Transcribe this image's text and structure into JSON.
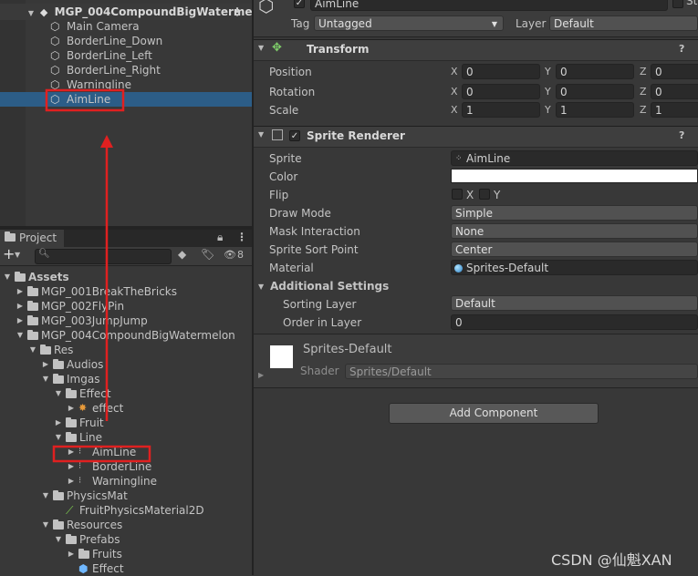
{
  "hierarchy": {
    "scene_name": "MGP_004CompoundBigWaterme",
    "items": [
      "Main Camera",
      "BorderLine_Down",
      "BorderLine_Left",
      "BorderLine_Right",
      "Warningline",
      "AimLine"
    ],
    "selected": "AimLine"
  },
  "project": {
    "tab_label": "Project",
    "add_label": "+",
    "hidden_count": "8",
    "tree": [
      {
        "label": "Assets",
        "depth": 0,
        "type": "folder",
        "arrow": "down",
        "bold": true
      },
      {
        "label": "MGP_001BreakTheBricks",
        "depth": 1,
        "type": "folder",
        "arrow": "right"
      },
      {
        "label": "MGP_002FlyPin",
        "depth": 1,
        "type": "folder",
        "arrow": "right"
      },
      {
        "label": "MGP_003JumpJump",
        "depth": 1,
        "type": "folder",
        "arrow": "right"
      },
      {
        "label": "MGP_004CompoundBigWatermelon",
        "depth": 1,
        "type": "folder",
        "arrow": "down"
      },
      {
        "label": "Res",
        "depth": 2,
        "type": "folder",
        "arrow": "down"
      },
      {
        "label": "Audios",
        "depth": 3,
        "type": "folder",
        "arrow": "right"
      },
      {
        "label": "Imgas",
        "depth": 3,
        "type": "folder",
        "arrow": "down"
      },
      {
        "label": "Effect",
        "depth": 4,
        "type": "folder",
        "arrow": "down"
      },
      {
        "label": "effect",
        "depth": 5,
        "type": "sprite",
        "arrow": "right"
      },
      {
        "label": "Fruit",
        "depth": 4,
        "type": "folder",
        "arrow": "right"
      },
      {
        "label": "Line",
        "depth": 4,
        "type": "folder",
        "arrow": "down"
      },
      {
        "label": "AimLine",
        "depth": 5,
        "type": "sprite-line",
        "arrow": "right"
      },
      {
        "label": "BorderLine",
        "depth": 5,
        "type": "sprite-line",
        "arrow": "right"
      },
      {
        "label": "Warningline",
        "depth": 5,
        "type": "sprite-line",
        "arrow": "right"
      },
      {
        "label": "PhysicsMat",
        "depth": 3,
        "type": "folder",
        "arrow": "down"
      },
      {
        "label": "FruitPhysicsMaterial2D",
        "depth": 4,
        "type": "physics",
        "arrow": ""
      },
      {
        "label": "Resources",
        "depth": 3,
        "type": "folder",
        "arrow": "down"
      },
      {
        "label": "Prefabs",
        "depth": 4,
        "type": "folder",
        "arrow": "down"
      },
      {
        "label": "Fruits",
        "depth": 5,
        "type": "folder",
        "arrow": "right"
      },
      {
        "label": "Effect",
        "depth": 5,
        "type": "prefab",
        "arrow": ""
      }
    ]
  },
  "inspector": {
    "object_name": "AimLine",
    "static_label": "St",
    "tag_label": "Tag",
    "tag_value": "Untagged",
    "layer_label": "Layer",
    "layer_value": "Default",
    "transform": {
      "title": "Transform",
      "position_label": "Position",
      "rotation_label": "Rotation",
      "scale_label": "Scale",
      "x": "X",
      "y": "Y",
      "z": "Z",
      "pos": [
        "0",
        "0",
        "0"
      ],
      "rot": [
        "0",
        "0",
        "0"
      ],
      "scl": [
        "1",
        "1",
        "1"
      ]
    },
    "sprite_renderer": {
      "title": "Sprite Renderer",
      "sprite_label": "Sprite",
      "sprite_value": "AimLine",
      "color_label": "Color",
      "color_value": "#ffffff",
      "flip_label": "Flip",
      "flip_x": "X",
      "flip_y": "Y",
      "draw_mode_label": "Draw Mode",
      "draw_mode_value": "Simple",
      "mask_label": "Mask Interaction",
      "mask_value": "None",
      "sort_point_label": "Sprite Sort Point",
      "sort_point_value": "Center",
      "material_label": "Material",
      "material_value": "Sprites-Default",
      "additional_label": "Additional Settings",
      "sorting_layer_label": "Sorting Layer",
      "sorting_layer_value": "Default",
      "order_label": "Order in Layer",
      "order_value": "0"
    },
    "material_preview": {
      "name": "Sprites-Default",
      "shader_label": "Shader",
      "shader_value": "Sprites/Default"
    },
    "add_component_label": "Add Component"
  },
  "watermark": "CSDN @仙魁XAN",
  "colors": {
    "annotation_red": "#e02020",
    "selection_blue": "#2c5d87"
  }
}
